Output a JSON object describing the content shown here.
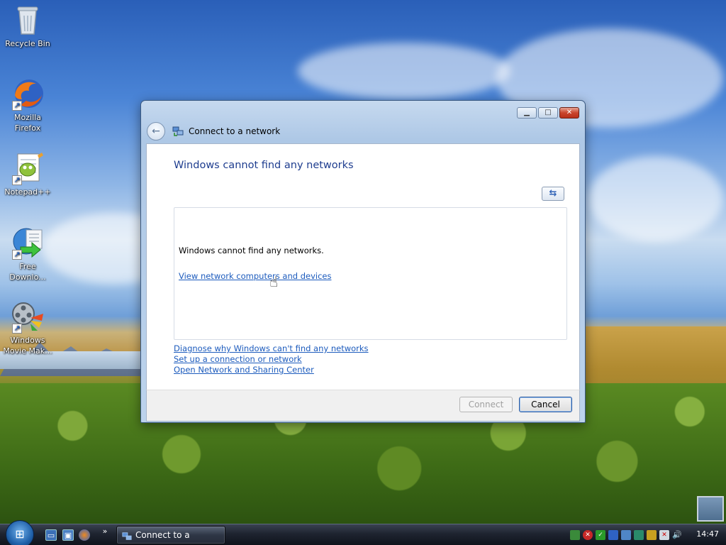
{
  "desktop": {
    "icons": [
      {
        "label": "Recycle Bin",
        "icon": "recycle-bin-icon"
      },
      {
        "label": "Mozilla Firefox",
        "icon": "firefox-icon"
      },
      {
        "label": "Notepad++",
        "icon": "notepad-plus-plus-icon"
      },
      {
        "label": "Free Downlo...",
        "icon": "free-download-manager-icon"
      },
      {
        "label": "Windows Movie Mak...",
        "icon": "windows-movie-maker-icon"
      }
    ]
  },
  "dialog": {
    "title": "Connect to a network",
    "headline": "Windows cannot find any networks",
    "list_message": "Windows cannot find any networks.",
    "list_link": "View network computers and devices",
    "links": [
      "Diagnose why Windows can't find any networks",
      "Set up a connection or network",
      "Open Network and Sharing Center"
    ],
    "connect_label": "Connect",
    "cancel_label": "Cancel"
  },
  "taskbar": {
    "task_label": "Connect to a network",
    "more_label": "»",
    "clock": "14:47"
  },
  "colors": {
    "headline": "#1e3d8f",
    "link": "#1c5bbd"
  }
}
